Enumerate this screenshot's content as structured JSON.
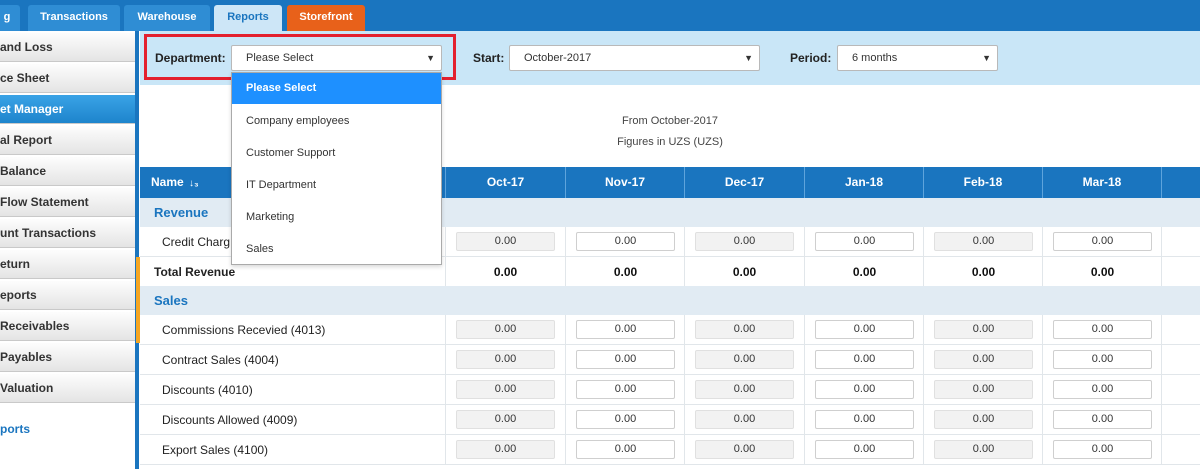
{
  "topnav": {
    "tabs": [
      {
        "label": "g"
      },
      {
        "label": "Transactions"
      },
      {
        "label": "Warehouse"
      },
      {
        "label": "Reports"
      },
      {
        "label": "Storefront"
      }
    ]
  },
  "sidebar": {
    "items": [
      {
        "label": "and Loss"
      },
      {
        "label": "ce Sheet"
      },
      {
        "label": "et Manager"
      },
      {
        "label": "al Report"
      },
      {
        "label": "Balance"
      },
      {
        "label": "Flow Statement"
      },
      {
        "label": "unt Transactions"
      },
      {
        "label": "eturn"
      },
      {
        "label": "eports"
      },
      {
        "label": "Receivables"
      },
      {
        "label": "Payables"
      },
      {
        "label": "Valuation"
      }
    ],
    "link": "ports"
  },
  "filters": {
    "department_label": "Department:",
    "department_value": "Please Select",
    "start_label": "Start:",
    "start_value": "October-2017",
    "period_label": "Period:",
    "period_value": "6 months"
  },
  "dropdown": {
    "options": [
      "Please Select",
      "Company employees",
      "Customer Support",
      "IT Department",
      "Marketing",
      "Sales"
    ]
  },
  "report": {
    "from_line": "From October-2017",
    "figures_line": "Figures in UZS (UZS)"
  },
  "table": {
    "name_header": "Name",
    "sort_icon": "↓₃",
    "months": [
      "Oct-17",
      "Nov-17",
      "Dec-17",
      "Jan-18",
      "Feb-18",
      "Mar-18"
    ],
    "sections": [
      {
        "title": "Revenue",
        "rows": [
          {
            "name": "Credit Charg",
            "values": [
              "0.00",
              "0.00",
              "0.00",
              "0.00",
              "0.00",
              "0.00"
            ]
          }
        ],
        "total_label": "Total Revenue",
        "totals": [
          "0.00",
          "0.00",
          "0.00",
          "0.00",
          "0.00",
          "0.00"
        ]
      },
      {
        "title": "Sales",
        "rows": [
          {
            "name": "Commissions Recevied (4013)",
            "values": [
              "0.00",
              "0.00",
              "0.00",
              "0.00",
              "0.00",
              "0.00"
            ]
          },
          {
            "name": "Contract Sales (4004)",
            "values": [
              "0.00",
              "0.00",
              "0.00",
              "0.00",
              "0.00",
              "0.00"
            ]
          },
          {
            "name": "Discounts (4010)",
            "values": [
              "0.00",
              "0.00",
              "0.00",
              "0.00",
              "0.00",
              "0.00"
            ]
          },
          {
            "name": "Discounts Allowed (4009)",
            "values": [
              "0.00",
              "0.00",
              "0.00",
              "0.00",
              "0.00",
              "0.00"
            ]
          },
          {
            "name": "Export Sales (4100)",
            "values": [
              "0.00",
              "0.00",
              "0.00",
              "0.00",
              "0.00",
              "0.00"
            ]
          }
        ]
      }
    ]
  },
  "colors": {
    "primary": "#1a75bf",
    "storefront_tab": "#e8611a",
    "highlight": "#e3202e",
    "dropdown_selected": "#1e90ff"
  }
}
